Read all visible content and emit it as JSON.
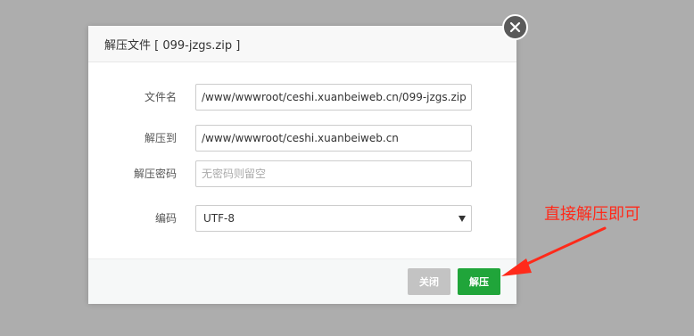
{
  "dialog": {
    "title": "解压文件 [ 099-jzgs.zip ]"
  },
  "form": {
    "filename": {
      "label": "文件名",
      "value": "/www/wwwroot/ceshi.xuanbeiweb.cn/099-jzgs.zip"
    },
    "extract_to": {
      "label": "解压到",
      "value": "/www/wwwroot/ceshi.xuanbeiweb.cn"
    },
    "password": {
      "label": "解压密码",
      "value": "",
      "placeholder": "无密码则留空"
    },
    "encoding": {
      "label": "编码",
      "selected": "UTF-8"
    }
  },
  "footer": {
    "cancel_label": "关闭",
    "confirm_label": "解压"
  },
  "annotation": {
    "text": "直接解压即可",
    "color": "#ff2a1a"
  },
  "colors": {
    "overlay": "#adadad",
    "confirm_button": "#20a53a",
    "cancel_button": "#c3c3c3",
    "annotation": "#ff2a1a"
  },
  "icons": {
    "close": "close-icon",
    "select_arrow": "caret-down-icon"
  }
}
